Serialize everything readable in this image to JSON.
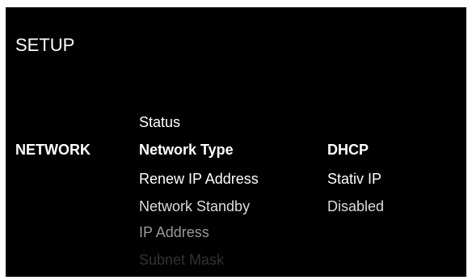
{
  "header": {
    "title": "SETUP"
  },
  "section": {
    "label": "NETWORK"
  },
  "menu": {
    "items": [
      {
        "label": "Status",
        "color": "#ffffff"
      },
      {
        "label": "Network Type",
        "color": "#ffffff"
      },
      {
        "label": "Renew IP Address",
        "color": "#ffffff"
      },
      {
        "label": "Network Standby",
        "color": "#dcdcdc"
      },
      {
        "label": "IP Address",
        "color": "#9a9a9a"
      },
      {
        "label": "Subnet Mask",
        "color": "#333333"
      }
    ],
    "values": [
      {
        "label": "DHCP",
        "color": "#ffffff"
      },
      {
        "label": "Stativ IP",
        "color": "#ffffff"
      },
      {
        "label": "Disabled",
        "color": "#dcdcdc"
      }
    ]
  },
  "colors": {
    "background": "#000000",
    "selected_text": "#ffffff"
  }
}
